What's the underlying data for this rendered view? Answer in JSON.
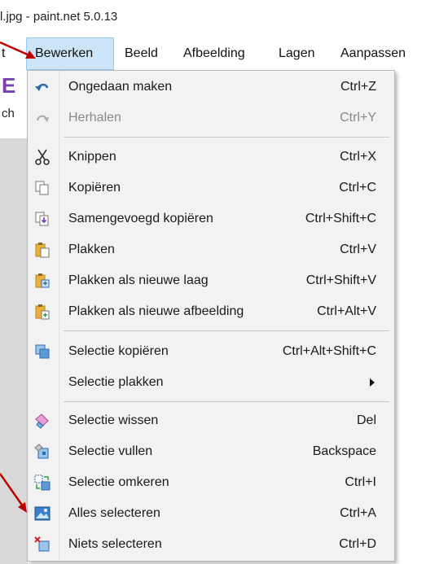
{
  "window": {
    "title": "l.jpg - paint.net 5.0.13"
  },
  "menubar": {
    "items": [
      {
        "label": "t"
      },
      {
        "label": "Bewerken"
      },
      {
        "label": "Beeld"
      },
      {
        "label": "Afbeelding"
      },
      {
        "label": "Lagen"
      },
      {
        "label": "Aanpassen"
      }
    ]
  },
  "background": {
    "left_text": "ch"
  },
  "menu": {
    "items": [
      {
        "label": "Ongedaan maken",
        "shortcut": "Ctrl+Z",
        "icon": "undo-icon",
        "enabled": true
      },
      {
        "label": "Herhalen",
        "shortcut": "Ctrl+Y",
        "icon": "redo-icon",
        "enabled": false
      },
      {
        "label": "Knippen",
        "shortcut": "Ctrl+X",
        "icon": "scissors-icon",
        "enabled": true
      },
      {
        "label": "Kopiëren",
        "shortcut": "Ctrl+C",
        "icon": "copy-icon",
        "enabled": true
      },
      {
        "label": "Samengevoegd kopiëren",
        "shortcut": "Ctrl+Shift+C",
        "icon": "copy-merged-icon",
        "enabled": true
      },
      {
        "label": "Plakken",
        "shortcut": "Ctrl+V",
        "icon": "paste-icon",
        "enabled": true
      },
      {
        "label": "Plakken als nieuwe laag",
        "shortcut": "Ctrl+Shift+V",
        "icon": "paste-new-layer-icon",
        "enabled": true
      },
      {
        "label": "Plakken als nieuwe afbeelding",
        "shortcut": "Ctrl+Alt+V",
        "icon": "paste-new-image-icon",
        "enabled": true
      },
      {
        "label": "Selectie kopiëren",
        "shortcut": "Ctrl+Alt+Shift+C",
        "icon": "copy-selection-icon",
        "enabled": true
      },
      {
        "label": "Selectie plakken",
        "shortcut": "",
        "icon": "",
        "enabled": true,
        "submenu": true
      },
      {
        "label": "Selectie wissen",
        "shortcut": "Del",
        "icon": "eraser-icon",
        "enabled": true
      },
      {
        "label": "Selectie vullen",
        "shortcut": "Backspace",
        "icon": "fill-selection-icon",
        "enabled": true
      },
      {
        "label": "Selectie omkeren",
        "shortcut": "Ctrl+I",
        "icon": "invert-selection-icon",
        "enabled": true
      },
      {
        "label": "Alles selecteren",
        "shortcut": "Ctrl+A",
        "icon": "select-all-icon",
        "enabled": true
      },
      {
        "label": "Niets selecteren",
        "shortcut": "Ctrl+D",
        "icon": "deselect-icon",
        "enabled": true
      }
    ]
  },
  "colors": {
    "menu_highlight": "#cce4f7",
    "menu_background": "#f2f2f2",
    "annotation_arrow": "#c00000",
    "icon_blue": "#2b6cb0",
    "icon_yellow": "#e8b23a"
  }
}
